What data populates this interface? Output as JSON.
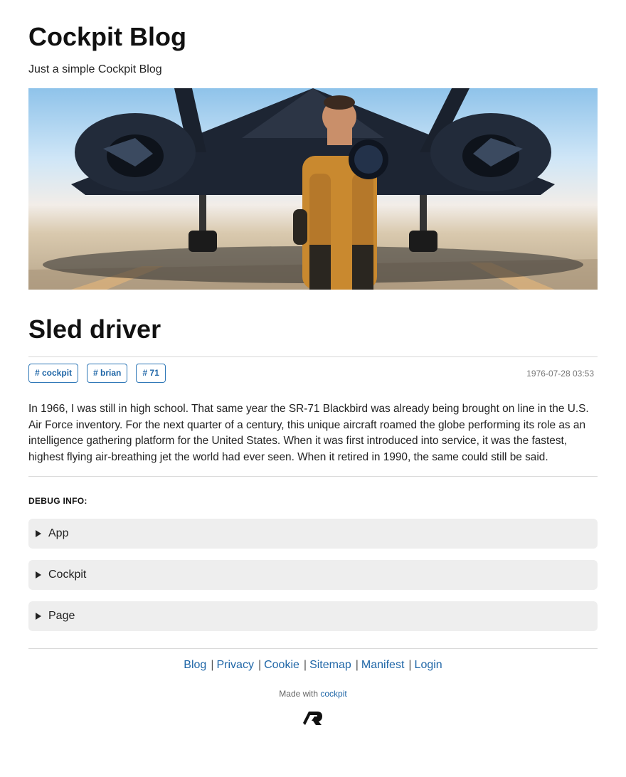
{
  "site": {
    "title": "Cockpit Blog",
    "subtitle": "Just a simple Cockpit Blog"
  },
  "hero": {
    "image_alt": "Pilot in orange pressure suit standing in front of an SR-71 Blackbird jet"
  },
  "post": {
    "title": "Sled driver",
    "tags": [
      "# cockpit",
      "# brian",
      "# 71"
    ],
    "date": "1976-07-28 03:53",
    "body": "In 1966, I was still in high school. That same year the SR-71 Blackbird was already being brought on line in the U.S. Air Force inventory. For the next quarter of a century, this unique aircraft roamed the globe performing its role as an intelligence gathering platform for the United States. When it was first introduced into service, it was the fastest, highest flying air-breathing jet the world had ever seen. When it retired in 1990, the same could still be said."
  },
  "debug": {
    "label": "DEBUG INFO:",
    "sections": [
      "App",
      "Cockpit",
      "Page"
    ]
  },
  "footer": {
    "links": [
      "Blog",
      "Privacy",
      "Cookie",
      "Sitemap",
      "Manifest",
      "Login"
    ],
    "separator": "|",
    "made_with_prefix": "Made with",
    "made_with_link": "cockpit"
  },
  "colors": {
    "link": "#1f66a7",
    "accordion_bg": "#eeeeee",
    "rule": "#d9d9d9"
  }
}
